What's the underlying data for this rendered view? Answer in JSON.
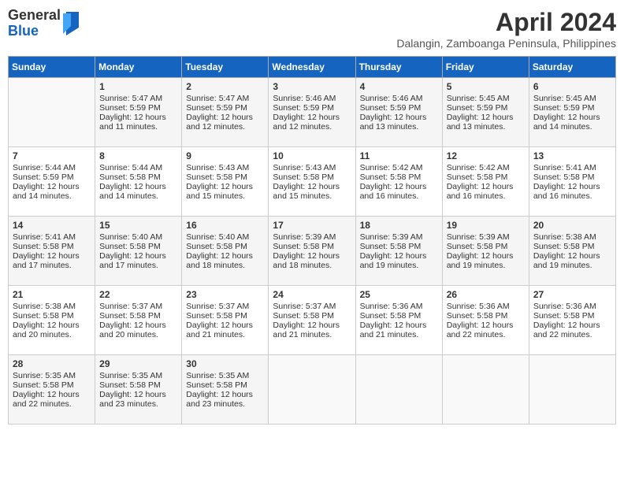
{
  "header": {
    "logo_general": "General",
    "logo_blue": "Blue",
    "month_title": "April 2024",
    "location": "Dalangin, Zamboanga Peninsula, Philippines"
  },
  "days_of_week": [
    "Sunday",
    "Monday",
    "Tuesday",
    "Wednesday",
    "Thursday",
    "Friday",
    "Saturday"
  ],
  "weeks": [
    [
      {
        "day": "",
        "data": ""
      },
      {
        "day": "1",
        "data": "Sunrise: 5:47 AM\nSunset: 5:59 PM\nDaylight: 12 hours\nand 11 minutes."
      },
      {
        "day": "2",
        "data": "Sunrise: 5:47 AM\nSunset: 5:59 PM\nDaylight: 12 hours\nand 12 minutes."
      },
      {
        "day": "3",
        "data": "Sunrise: 5:46 AM\nSunset: 5:59 PM\nDaylight: 12 hours\nand 12 minutes."
      },
      {
        "day": "4",
        "data": "Sunrise: 5:46 AM\nSunset: 5:59 PM\nDaylight: 12 hours\nand 13 minutes."
      },
      {
        "day": "5",
        "data": "Sunrise: 5:45 AM\nSunset: 5:59 PM\nDaylight: 12 hours\nand 13 minutes."
      },
      {
        "day": "6",
        "data": "Sunrise: 5:45 AM\nSunset: 5:59 PM\nDaylight: 12 hours\nand 14 minutes."
      }
    ],
    [
      {
        "day": "7",
        "data": "Sunrise: 5:44 AM\nSunset: 5:59 PM\nDaylight: 12 hours\nand 14 minutes."
      },
      {
        "day": "8",
        "data": "Sunrise: 5:44 AM\nSunset: 5:58 PM\nDaylight: 12 hours\nand 14 minutes."
      },
      {
        "day": "9",
        "data": "Sunrise: 5:43 AM\nSunset: 5:58 PM\nDaylight: 12 hours\nand 15 minutes."
      },
      {
        "day": "10",
        "data": "Sunrise: 5:43 AM\nSunset: 5:58 PM\nDaylight: 12 hours\nand 15 minutes."
      },
      {
        "day": "11",
        "data": "Sunrise: 5:42 AM\nSunset: 5:58 PM\nDaylight: 12 hours\nand 16 minutes."
      },
      {
        "day": "12",
        "data": "Sunrise: 5:42 AM\nSunset: 5:58 PM\nDaylight: 12 hours\nand 16 minutes."
      },
      {
        "day": "13",
        "data": "Sunrise: 5:41 AM\nSunset: 5:58 PM\nDaylight: 12 hours\nand 16 minutes."
      }
    ],
    [
      {
        "day": "14",
        "data": "Sunrise: 5:41 AM\nSunset: 5:58 PM\nDaylight: 12 hours\nand 17 minutes."
      },
      {
        "day": "15",
        "data": "Sunrise: 5:40 AM\nSunset: 5:58 PM\nDaylight: 12 hours\nand 17 minutes."
      },
      {
        "day": "16",
        "data": "Sunrise: 5:40 AM\nSunset: 5:58 PM\nDaylight: 12 hours\nand 18 minutes."
      },
      {
        "day": "17",
        "data": "Sunrise: 5:39 AM\nSunset: 5:58 PM\nDaylight: 12 hours\nand 18 minutes."
      },
      {
        "day": "18",
        "data": "Sunrise: 5:39 AM\nSunset: 5:58 PM\nDaylight: 12 hours\nand 19 minutes."
      },
      {
        "day": "19",
        "data": "Sunrise: 5:39 AM\nSunset: 5:58 PM\nDaylight: 12 hours\nand 19 minutes."
      },
      {
        "day": "20",
        "data": "Sunrise: 5:38 AM\nSunset: 5:58 PM\nDaylight: 12 hours\nand 19 minutes."
      }
    ],
    [
      {
        "day": "21",
        "data": "Sunrise: 5:38 AM\nSunset: 5:58 PM\nDaylight: 12 hours\nand 20 minutes."
      },
      {
        "day": "22",
        "data": "Sunrise: 5:37 AM\nSunset: 5:58 PM\nDaylight: 12 hours\nand 20 minutes."
      },
      {
        "day": "23",
        "data": "Sunrise: 5:37 AM\nSunset: 5:58 PM\nDaylight: 12 hours\nand 21 minutes."
      },
      {
        "day": "24",
        "data": "Sunrise: 5:37 AM\nSunset: 5:58 PM\nDaylight: 12 hours\nand 21 minutes."
      },
      {
        "day": "25",
        "data": "Sunrise: 5:36 AM\nSunset: 5:58 PM\nDaylight: 12 hours\nand 21 minutes."
      },
      {
        "day": "26",
        "data": "Sunrise: 5:36 AM\nSunset: 5:58 PM\nDaylight: 12 hours\nand 22 minutes."
      },
      {
        "day": "27",
        "data": "Sunrise: 5:36 AM\nSunset: 5:58 PM\nDaylight: 12 hours\nand 22 minutes."
      }
    ],
    [
      {
        "day": "28",
        "data": "Sunrise: 5:35 AM\nSunset: 5:58 PM\nDaylight: 12 hours\nand 22 minutes."
      },
      {
        "day": "29",
        "data": "Sunrise: 5:35 AM\nSunset: 5:58 PM\nDaylight: 12 hours\nand 23 minutes."
      },
      {
        "day": "30",
        "data": "Sunrise: 5:35 AM\nSunset: 5:58 PM\nDaylight: 12 hours\nand 23 minutes."
      },
      {
        "day": "",
        "data": ""
      },
      {
        "day": "",
        "data": ""
      },
      {
        "day": "",
        "data": ""
      },
      {
        "day": "",
        "data": ""
      }
    ]
  ]
}
